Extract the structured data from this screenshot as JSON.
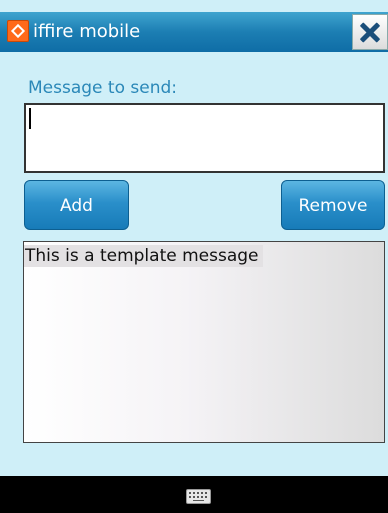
{
  "window": {
    "title": "iffire mobile",
    "icon": "iffire-app-icon",
    "close_icon": "close-icon"
  },
  "form": {
    "message_label": "Message to send:",
    "message_value": "",
    "add_label": "Add",
    "remove_label": "Remove"
  },
  "templates": {
    "items": [
      "This is a template message"
    ]
  },
  "bottom_bar": {
    "keyboard_icon": "keyboard-icon"
  }
}
